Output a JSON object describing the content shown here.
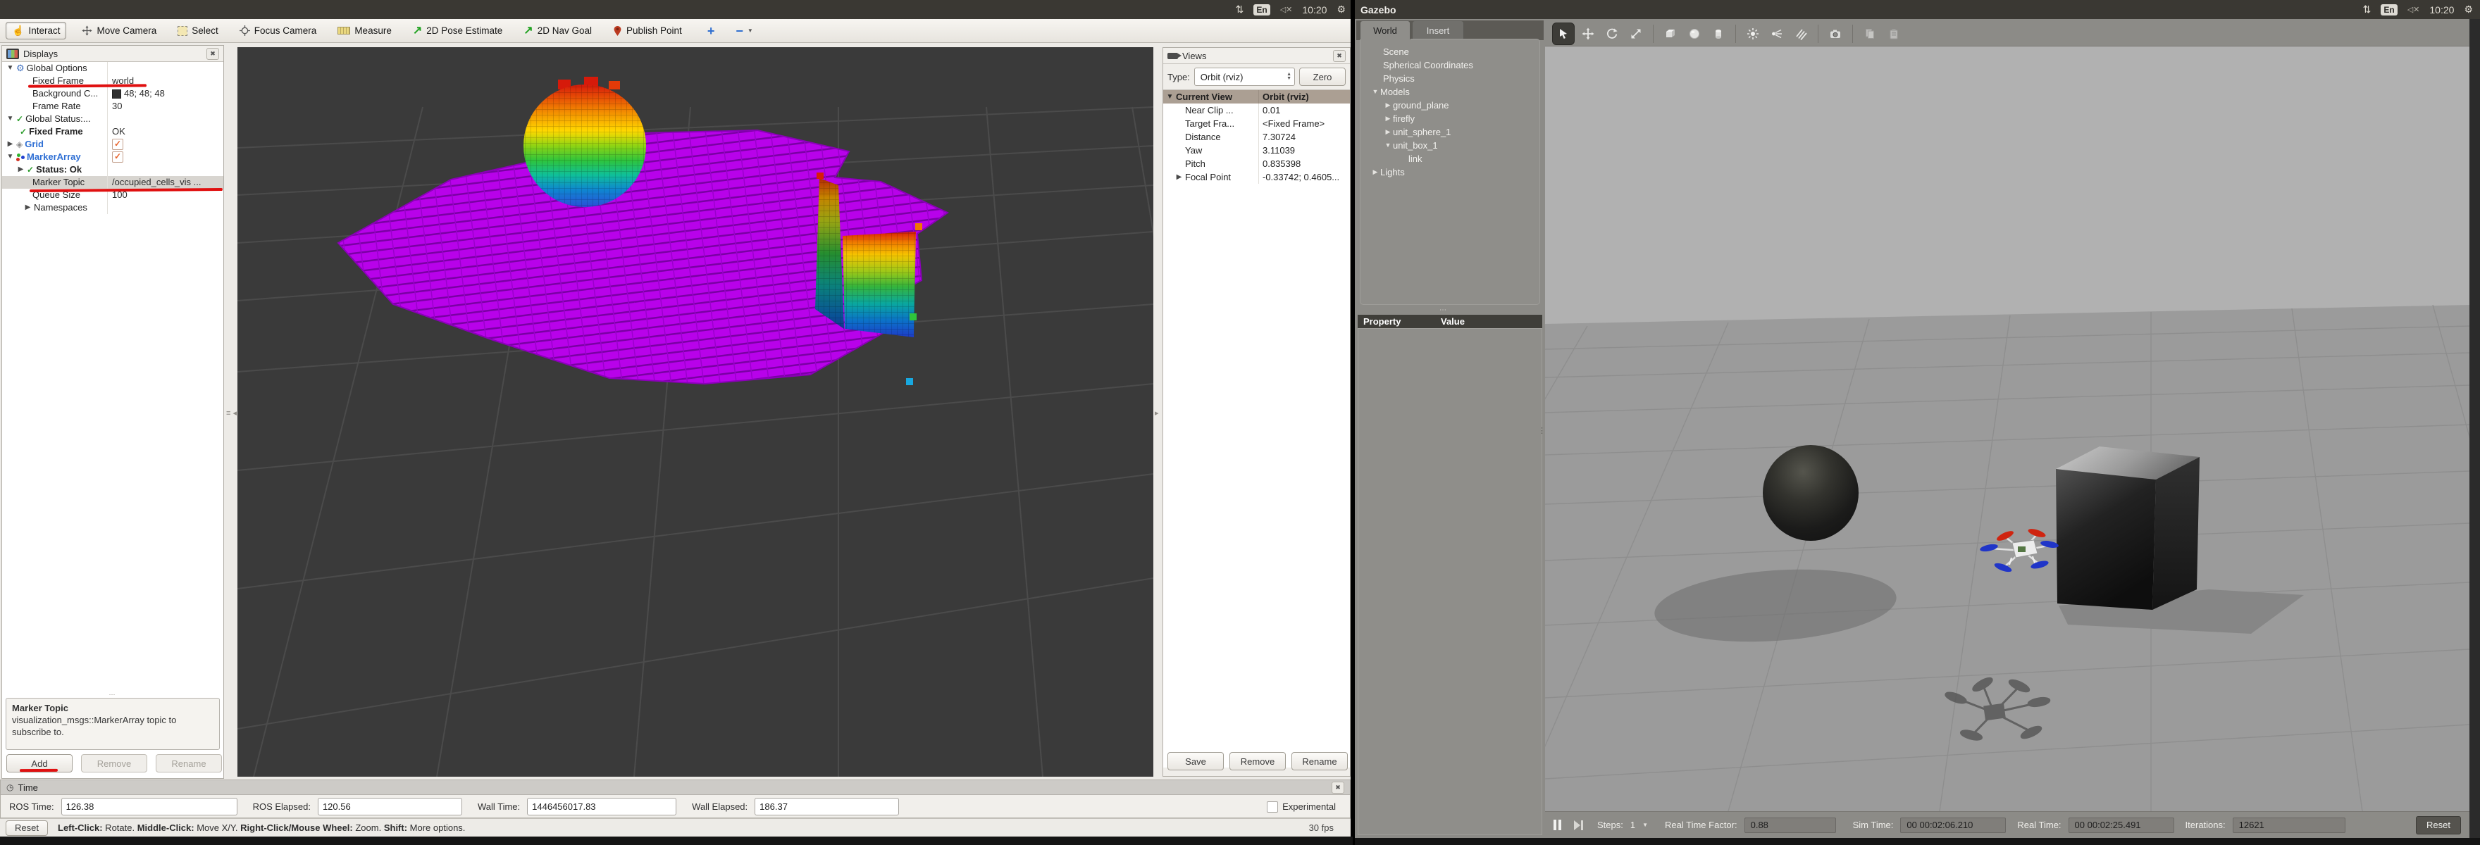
{
  "colors": {
    "annotation_red": "#e01010",
    "rviz_display_blue": "#2e6fd4",
    "octomap_purple": "#bb00ef",
    "rviz_viewport_bg": "#3a3a3a",
    "gazebo_sky": "#b1b1b1",
    "gazebo_ground": "#9b9b9b",
    "ubuntu_panel": "#3a3833"
  },
  "top_bar_left": {
    "keyboard_indicator": "En",
    "clock": "10:20"
  },
  "top_bar_right": {
    "window_title": "Gazebo",
    "keyboard_indicator": "En",
    "clock": "10:20"
  },
  "rviz": {
    "toolbar": {
      "buttons": [
        {
          "label": "Interact"
        },
        {
          "label": "Move Camera"
        },
        {
          "label": "Select"
        },
        {
          "label": "Focus Camera"
        },
        {
          "label": "Measure"
        },
        {
          "label": "2D Pose Estimate"
        },
        {
          "label": "2D Nav Goal"
        },
        {
          "label": "Publish Point"
        }
      ],
      "plus_label": "+",
      "minus_label": "−"
    },
    "displays": {
      "title": "Displays",
      "rows": [
        {
          "label": "Global Options",
          "value": ""
        },
        {
          "label": "Fixed Frame",
          "value": "world"
        },
        {
          "label": "Background C...",
          "value": "48; 48; 48"
        },
        {
          "label": "Frame Rate",
          "value": "30"
        },
        {
          "label": "Global Status:...",
          "value": ""
        },
        {
          "label": "Fixed Frame",
          "value": "OK"
        },
        {
          "label": "Grid",
          "value": ""
        },
        {
          "label": "MarkerArray",
          "value": ""
        },
        {
          "label": "Status: Ok",
          "value": ""
        },
        {
          "label": "Marker Topic",
          "value": "/occupied_cells_vis ..."
        },
        {
          "label": "Queue Size",
          "value": "100"
        },
        {
          "label": "Namespaces",
          "value": ""
        }
      ],
      "help_title": "Marker Topic",
      "help_text": "visualization_msgs::MarkerArray topic to subscribe to.",
      "buttons": {
        "add": "Add",
        "remove": "Remove",
        "rename": "Rename"
      }
    },
    "views": {
      "title": "Views",
      "type_label": "Type:",
      "type_value": "Orbit (rviz)",
      "zero": "Zero",
      "rows": [
        {
          "label": "Current View",
          "value": "Orbit (rviz)"
        },
        {
          "label": "Near Clip ...",
          "value": "0.01"
        },
        {
          "label": "Target Fra...",
          "value": "<Fixed Frame>"
        },
        {
          "label": "Distance",
          "value": "7.30724"
        },
        {
          "label": "Yaw",
          "value": "3.11039"
        },
        {
          "label": "Pitch",
          "value": "0.835398"
        },
        {
          "label": "Focal Point",
          "value": "-0.33742; 0.4605..."
        }
      ],
      "buttons": {
        "save": "Save",
        "remove": "Remove",
        "rename": "Rename"
      }
    },
    "time_panel": {
      "title": "Time",
      "fields": [
        {
          "label": "ROS Time:",
          "value": "126.38"
        },
        {
          "label": "ROS Elapsed:",
          "value": "120.56"
        },
        {
          "label": "Wall Time:",
          "value": "1446456017.83"
        },
        {
          "label": "Wall Elapsed:",
          "value": "186.37"
        }
      ],
      "experimental": "Experimental"
    },
    "status_bar": {
      "reset": "Reset",
      "help_parts": [
        "Left-Click:",
        " Rotate.  ",
        "Middle-Click:",
        " Move X/Y.  ",
        "Right-Click/Mouse Wheel:",
        " Zoom.  ",
        "Shift:",
        " More options."
      ],
      "fps": "30 fps"
    }
  },
  "gazebo": {
    "tabs": {
      "world": "World",
      "insert": "Insert"
    },
    "tree": [
      {
        "label": "Scene"
      },
      {
        "label": "Spherical Coordinates"
      },
      {
        "label": "Physics"
      },
      {
        "label": "Models"
      },
      {
        "label": "ground_plane"
      },
      {
        "label": "firefly"
      },
      {
        "label": "unit_sphere_1"
      },
      {
        "label": "unit_box_1"
      },
      {
        "label": "link"
      },
      {
        "label": "Lights"
      }
    ],
    "property_table": {
      "property": "Property",
      "value": "Value"
    },
    "bottom_bar": {
      "steps_label": "Steps:",
      "steps_value": "1",
      "rtf_label": "Real Time Factor:",
      "rtf_value": "0.88",
      "sim_time_label": "Sim Time:",
      "sim_time_value": "00 00:02:06.210",
      "real_time_label": "Real Time:",
      "real_time_value": "00 00:02:25.491",
      "iterations_label": "Iterations:",
      "iterations_value": "12621",
      "reset": "Reset"
    }
  }
}
